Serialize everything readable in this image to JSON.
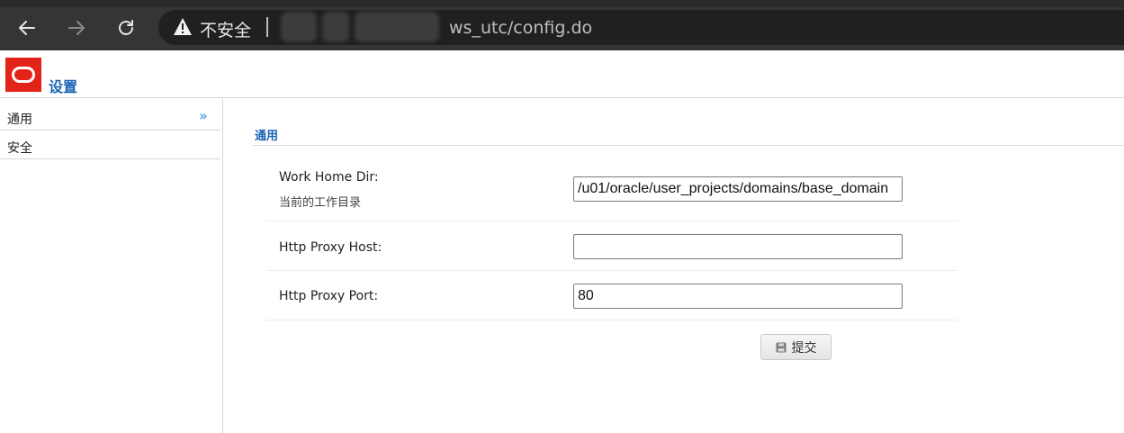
{
  "browser": {
    "security_label": "不安全",
    "url_visible": "ws_utc/config.do"
  },
  "header": {
    "title": "设置"
  },
  "sidebar": {
    "items": [
      {
        "label": "通用",
        "active": true
      },
      {
        "label": "安全",
        "active": false
      }
    ]
  },
  "main": {
    "section_title": "通用",
    "fields": [
      {
        "label": "Work Home Dir:",
        "sublabel": "当前的工作目录",
        "value": "/u01/oracle/user_projects/domains/base_domain"
      },
      {
        "label": "Http Proxy Host:",
        "value": ""
      },
      {
        "label": "Http Proxy Port:",
        "value": "80"
      }
    ],
    "submit_label": "提交"
  },
  "colors": {
    "brand_red": "#e2231a",
    "accent_blue": "#1a63b5",
    "chrome_dark": "#353535"
  }
}
